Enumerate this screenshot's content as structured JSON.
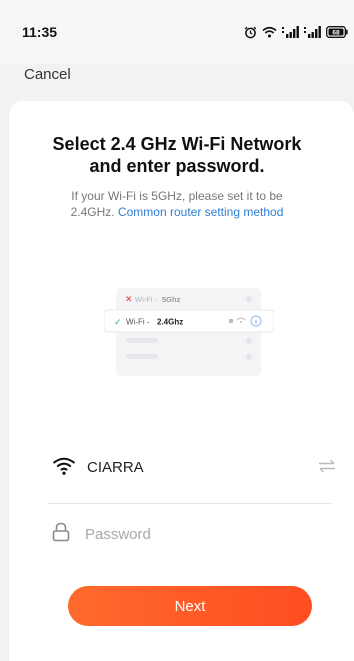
{
  "status_bar": {
    "time": "11:35",
    "battery": "68"
  },
  "nav": {
    "cancel_label": "Cancel"
  },
  "content": {
    "title_line1": "Select 2.4 GHz Wi-Fi Network",
    "title_line2": "and enter password.",
    "subtitle_line1": "If your Wi-Fi is 5GHz, please set it to be",
    "subtitle_line2_prefix": "2.4GHz.",
    "subtitle_link": "Common router setting method"
  },
  "illustration": {
    "row1_prefix": "Wi-Fi - ",
    "row1_band": "5Ghz",
    "row2_prefix": "Wi-Fi - ",
    "row2_band": "2.4Ghz"
  },
  "form": {
    "wifi_name": "CIARRA",
    "password_placeholder": "Password",
    "password_value": ""
  },
  "actions": {
    "next_label": "Next"
  },
  "colors": {
    "accent": "#ff5a26",
    "link": "#2f7fd1",
    "check": "#2bb673",
    "cross": "#e53935"
  },
  "icons": {
    "wifi": "wifi-icon",
    "lock": "lock-icon",
    "switch": "switch-network-icon"
  }
}
